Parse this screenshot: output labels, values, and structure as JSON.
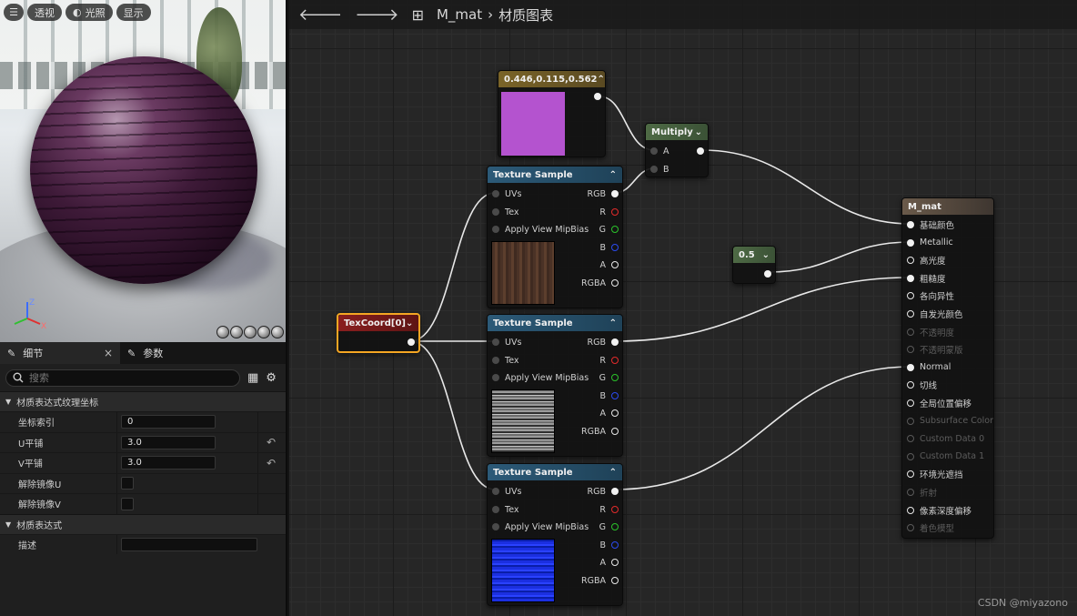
{
  "viewport": {
    "buttons": [
      {
        "icon": "menu-icon",
        "label": ""
      },
      {
        "icon": "",
        "label": "透视"
      },
      {
        "icon": "lit-icon",
        "label": "光照"
      },
      {
        "icon": "",
        "label": "显示"
      }
    ],
    "axis": {
      "z": "Z",
      "x": "X"
    }
  },
  "details": {
    "tabs": [
      {
        "label": "细节",
        "icon": "details-icon",
        "close": "×"
      },
      {
        "label": "参数",
        "icon": "parameters-icon"
      }
    ],
    "search_placeholder": "搜索",
    "categories": [
      {
        "title": "材质表达式纹理坐标",
        "rows": [
          {
            "label": "坐标索引",
            "value": "0",
            "type": "number"
          },
          {
            "label": "U平铺",
            "value": "3.0",
            "type": "number",
            "reset": true
          },
          {
            "label": "V平铺",
            "value": "3.0",
            "type": "number",
            "reset": true
          },
          {
            "label": "解除镜像U",
            "value": false,
            "type": "checkbox"
          },
          {
            "label": "解除镜像V",
            "value": false,
            "type": "checkbox"
          }
        ]
      },
      {
        "title": "材质表达式",
        "rows": [
          {
            "label": "描述",
            "value": "",
            "type": "text"
          }
        ]
      }
    ]
  },
  "graph": {
    "breadcrumb": {
      "asset": "M_mat",
      "separator": "›",
      "page": "材质图表"
    },
    "watermark": "CSDN @miyazono",
    "constant_node": {
      "title": "0.446,0.115,0.562",
      "swatch": "#b453cf",
      "header_color": "#7a6428"
    },
    "multiply_node": {
      "title": "Multiply",
      "inputs": [
        "A",
        "B"
      ],
      "header_color": "#4e6a45"
    },
    "scalar_node": {
      "title": "0.5",
      "header_color": "#4e6a45"
    },
    "texcoord_node": {
      "title": "TexCoord[0]",
      "header_color": "#8a1f1f",
      "highlight": "#f5a623"
    },
    "texture_nodes": [
      {
        "title": "Texture Sample",
        "inputs": [
          "UVs",
          "Tex",
          "Apply View MipBias"
        ],
        "outputs": [
          "RGB",
          "R",
          "G",
          "B",
          "A",
          "RGBA"
        ],
        "texture": "brown-wood"
      },
      {
        "title": "Texture Sample",
        "inputs": [
          "UVs",
          "Tex",
          "Apply View MipBias"
        ],
        "outputs": [
          "RGB",
          "R",
          "G",
          "B",
          "A",
          "RGBA"
        ],
        "texture": "grey-roughness"
      },
      {
        "title": "Texture Sample",
        "inputs": [
          "UVs",
          "Tex",
          "Apply View MipBias"
        ],
        "outputs": [
          "RGB",
          "R",
          "G",
          "B",
          "A",
          "RGBA"
        ],
        "texture": "blue-normal"
      }
    ],
    "texture_header_color": "#2c5a78",
    "material_node": {
      "title": "M_mat",
      "inputs": [
        {
          "label": "基础颜色",
          "state": "connected"
        },
        {
          "label": "Metallic",
          "state": "connected"
        },
        {
          "label": "高光度",
          "state": "open"
        },
        {
          "label": "粗糙度",
          "state": "connected"
        },
        {
          "label": "各向异性",
          "state": "open"
        },
        {
          "label": "自发光颜色",
          "state": "open"
        },
        {
          "label": "不透明度",
          "state": "disabled"
        },
        {
          "label": "不透明蒙版",
          "state": "disabled"
        },
        {
          "label": "Normal",
          "state": "connected"
        },
        {
          "label": "切线",
          "state": "open"
        },
        {
          "label": "全局位置偏移",
          "state": "open"
        },
        {
          "label": "Subsurface Color",
          "state": "disabled"
        },
        {
          "label": "Custom Data 0",
          "state": "disabled"
        },
        {
          "label": "Custom Data 1",
          "state": "disabled"
        },
        {
          "label": "环境光遮挡",
          "state": "open"
        },
        {
          "label": "折射",
          "state": "disabled"
        },
        {
          "label": "像素深度偏移",
          "state": "open"
        },
        {
          "label": "着色模型",
          "state": "disabled"
        }
      ]
    }
  }
}
